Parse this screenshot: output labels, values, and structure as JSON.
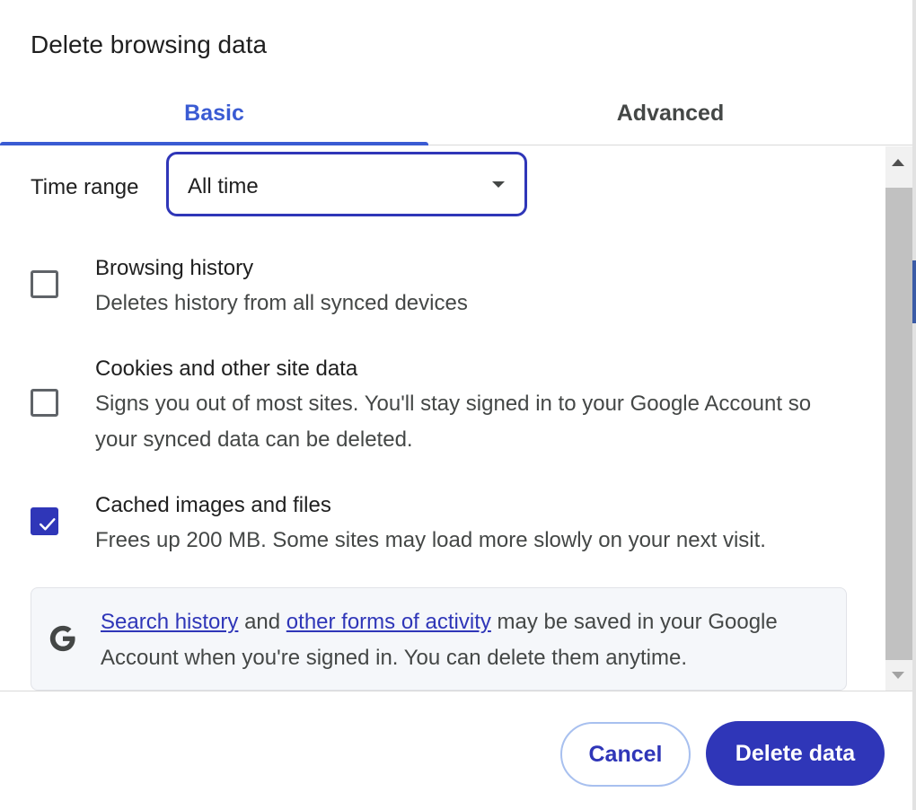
{
  "dialog": {
    "title": "Delete browsing data"
  },
  "tabs": [
    {
      "label": "Basic",
      "selected": true
    },
    {
      "label": "Advanced",
      "selected": false
    }
  ],
  "time_range": {
    "label": "Time range",
    "value": "All time"
  },
  "options": [
    {
      "title": "Browsing history",
      "description": "Deletes history from all synced devices",
      "checked": false
    },
    {
      "title": "Cookies and other site data",
      "description": "Signs you out of most sites. You'll stay signed in to your Google Account so your synced data can be deleted.",
      "checked": false
    },
    {
      "title": "Cached images and files",
      "description": "Frees up 200 MB. Some sites may load more slowly on your next visit.",
      "checked": true
    }
  ],
  "info": {
    "icon": "google-g-icon",
    "link1": "Search history",
    "text1": " and ",
    "link2": "other forms of activity",
    "text2": " may be saved in your Google Account when you're signed in. You can delete them anytime."
  },
  "footer": {
    "cancel_label": "Cancel",
    "delete_label": "Delete data"
  },
  "colors": {
    "accent": "#3a5bd3",
    "primary_button": "#2f36b8",
    "checkbox_checked": "#2f36b8"
  }
}
